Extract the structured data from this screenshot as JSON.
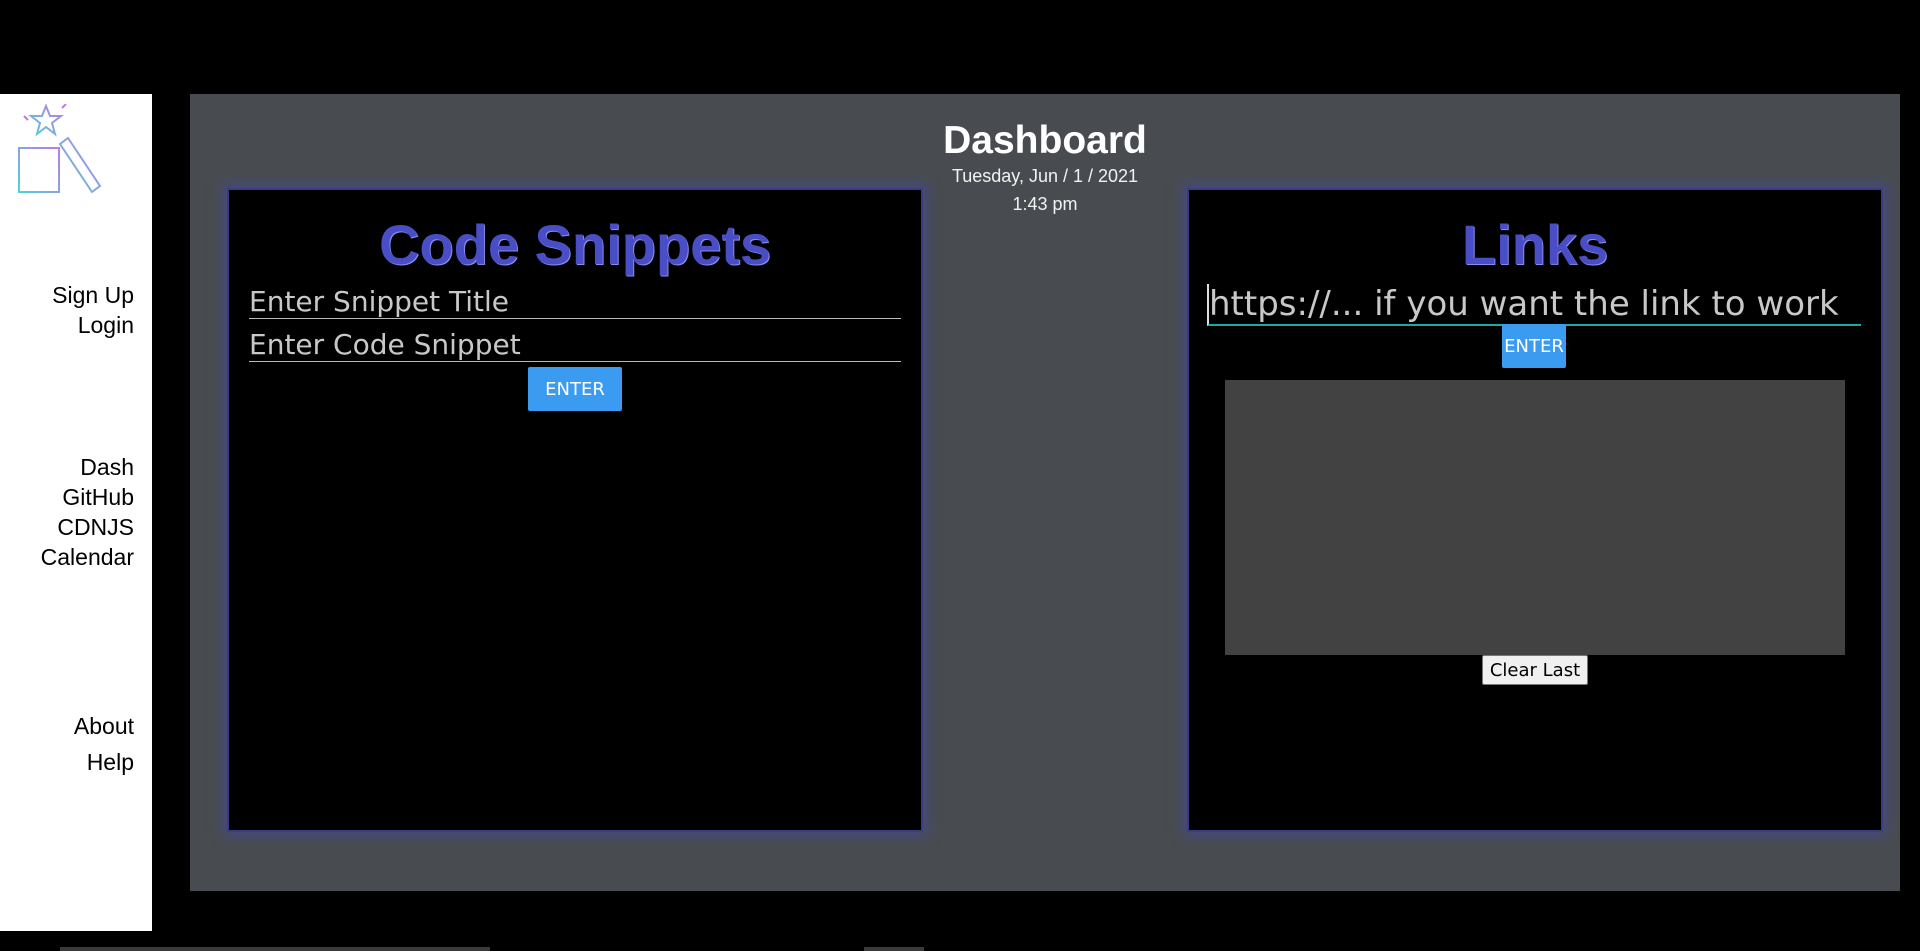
{
  "sidebar": {
    "auth": [
      "Sign Up",
      "Login"
    ],
    "nav": [
      "Dash",
      "GitHub",
      "CDNJS",
      "Calendar"
    ],
    "info": [
      "About",
      "Help"
    ],
    "logo_icon": "magic-wand-stars-logo"
  },
  "header": {
    "title": "Dashboard",
    "date": "Tuesday, Jun / 1 / 2021",
    "time": "1:43 pm"
  },
  "snippets": {
    "title": "Code Snippets",
    "title_placeholder": "Enter Snippet Title",
    "code_placeholder": "Enter Code Snippet",
    "enter_label": "ENTER"
  },
  "links": {
    "title": "Links",
    "input_placeholder": "https://... if you want the link to work",
    "enter_label": "ENTER",
    "clear_label": "Clear Last"
  },
  "colors": {
    "accent_title": "#4a4ec6",
    "button_blue": "#3a9bf0",
    "panel_bg": "#484c50"
  }
}
